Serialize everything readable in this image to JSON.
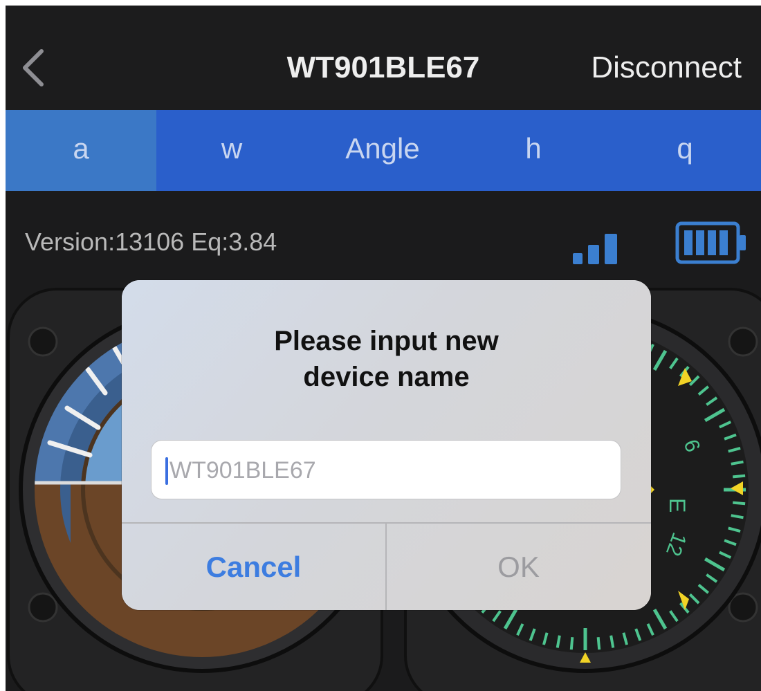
{
  "header": {
    "title": "WT901BLE67",
    "disconnect_label": "Disconnect"
  },
  "tabs": [
    {
      "label": "a",
      "active": true
    },
    {
      "label": "w",
      "active": false
    },
    {
      "label": "Angle",
      "active": false
    },
    {
      "label": "h",
      "active": false
    },
    {
      "label": "q",
      "active": false
    }
  ],
  "status": {
    "version_text": "Version:13106 Eq:3.84",
    "signal_icon": "signal-bars-icon",
    "battery_icon": "battery-full-icon"
  },
  "compass": {
    "labels": [
      "6",
      "E",
      "12"
    ]
  },
  "dialog": {
    "title_line1": "Please input new",
    "title_line2": "device name",
    "input_placeholder": "WT901BLE67",
    "input_value": "",
    "cancel_label": "Cancel",
    "ok_label": "OK"
  },
  "colors": {
    "tab_bar": "#2a5fcb",
    "tab_active": "#3b78c6",
    "cancel_blue": "#3d7de0",
    "sky": "#4d77ad",
    "ground": "#6b4527",
    "compass_tick": "#4ec48f",
    "compass_marker": "#f1d326"
  }
}
